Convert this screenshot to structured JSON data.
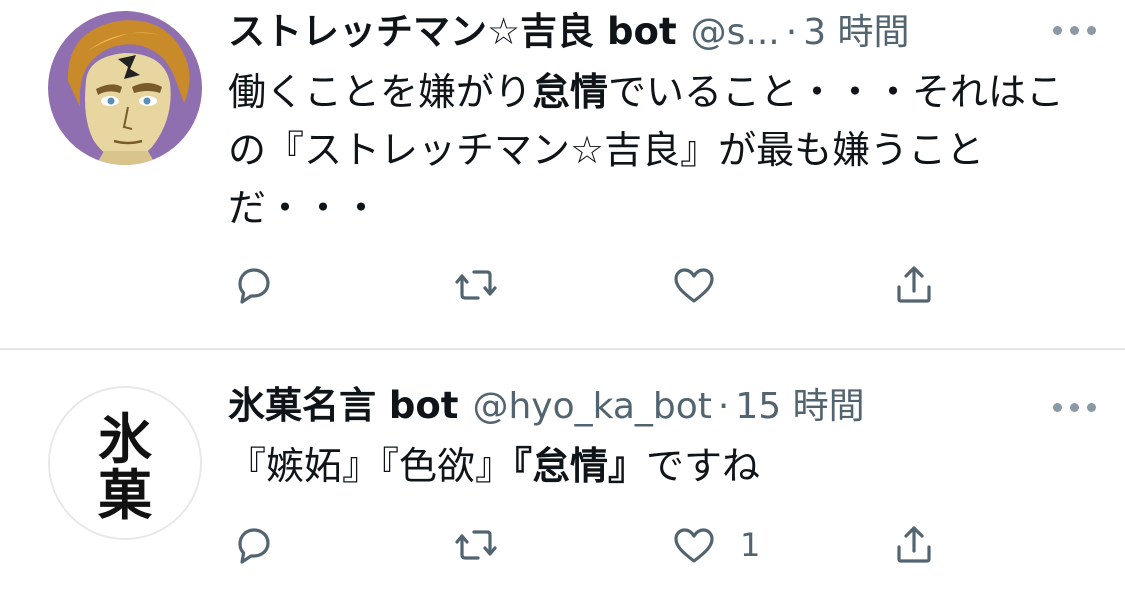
{
  "colors": {
    "text": "#0f1419",
    "secondary": "#536471",
    "icon": "#536471",
    "divider": "#e6e6e6"
  },
  "tweets": [
    {
      "name": "ストレッチマン☆吉良 bot",
      "handle": "@s...",
      "separator": "·",
      "time": "3 時間",
      "text_parts": [
        "働くことを嫌がり",
        "怠情",
        "でいること・・・それはこの『ストレッチマン☆吉良』が最も嫌うことだ・・・"
      ],
      "avatar_icon": "kira-portrait-avatar",
      "actions": {
        "reply_icon": "reply-icon",
        "retweet_icon": "retweet-icon",
        "like_icon": "heart-icon",
        "like_count": "",
        "share_icon": "share-icon"
      },
      "more_icon": "more-options-icon"
    },
    {
      "name": "氷菓名言 bot",
      "handle": "@hyo_ka_bot",
      "separator": "·",
      "time": "15 時間",
      "text_parts": [
        "『嫉妬』『色欲』",
        "『怠情』",
        "ですね"
      ],
      "avatar_icon": "hyouka-kanji-avatar",
      "avatar_text": "氷菓",
      "actions": {
        "reply_icon": "reply-icon",
        "retweet_icon": "retweet-icon",
        "like_icon": "heart-icon",
        "like_count": "1",
        "share_icon": "share-icon"
      },
      "more_icon": "more-options-icon"
    }
  ]
}
